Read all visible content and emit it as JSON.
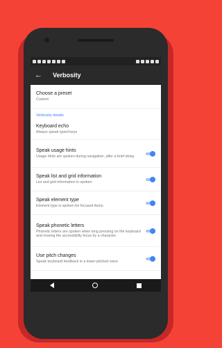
{
  "app_bar": {
    "title": "Verbosity"
  },
  "preset": {
    "title": "Choose a preset",
    "value": "Custom"
  },
  "section_header": "Verbosity details",
  "keyboard_echo": {
    "title": "Keyboard echo",
    "subtitle": "Always speak typed keys"
  },
  "toggles": [
    {
      "title": "Speak usage hints",
      "subtitle": "Usage hints are spoken during navigation, after a brief delay.",
      "on": true
    },
    {
      "title": "Speak list and grid information",
      "subtitle": "List and grid information is spoken.",
      "on": true
    },
    {
      "title": "Speak element type",
      "subtitle": "Element type is spoken for focused items.",
      "on": true
    },
    {
      "title": "Speak phonetic letters",
      "subtitle": "Phonetic letters are spoken when long pressing on the keyboard and moving the accessibility focus by a character.",
      "on": true
    },
    {
      "title": "Use pitch changes",
      "subtitle": "Speak keyboard feedback in a lower-pitched voice",
      "on": true
    }
  ],
  "colors": {
    "accent": "#4285f4",
    "background": "#f44336"
  }
}
